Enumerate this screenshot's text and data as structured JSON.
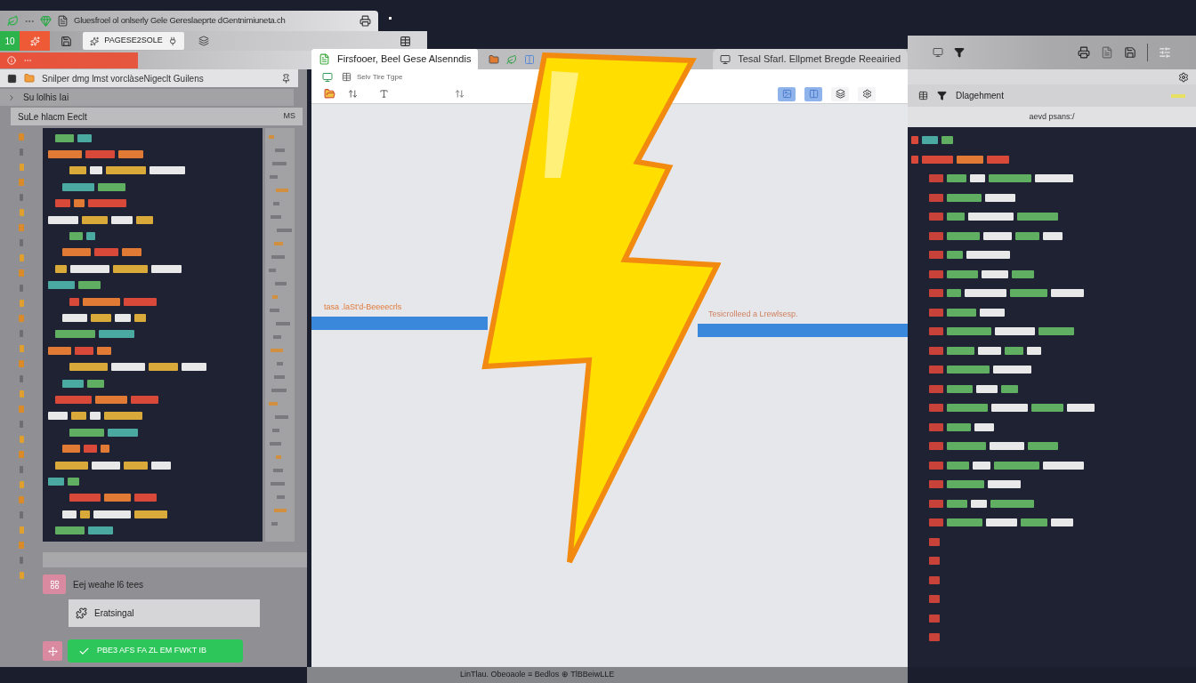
{
  "left_window": {
    "title": "Gluesfroel ol onlserly Gele Gereslaeprte dGentnimiuneta.ch",
    "toolbar": {
      "counter": "10",
      "tab": "PAGESE2SOLE"
    },
    "panel": {
      "header": "Snilper dmg lmst vorclàseNigeclt Guilens",
      "section": "Su lolhis Iai",
      "file_row": {
        "name": "SuLe hlacm Eeclt",
        "badge": "MS"
      }
    },
    "footer": {
      "label": "Eej weahe l6 tees",
      "input_value": "Eratsingal",
      "button": "PBE3 AFS FA ZL EM FWKT IB"
    }
  },
  "canvas_window": {
    "tabs": [
      {
        "label": "Firsfooer, Beel Gese Alsenndis",
        "selected": true
      },
      {
        "label": "Tesal Sfarl. Ellpmet Bregde Reeairied",
        "selected": false
      }
    ],
    "toolbar_label": "Selv Tire Tgpe",
    "view_buttons": [
      {
        "selected": true
      },
      {
        "selected": true
      },
      {
        "selected": false
      },
      {
        "selected": false
      }
    ],
    "labels": [
      "tasa .laSt'd-Beeeecrls",
      "Tesicrolleed a Lrewlsesp."
    ]
  },
  "right_panel": {
    "title": "Dlagehment",
    "path": "aevd psans:/"
  },
  "status_bar": {
    "text": "LinTlau. Obeoaole ≡ Bedlos ⊕ TlBBeiwLLE"
  }
}
